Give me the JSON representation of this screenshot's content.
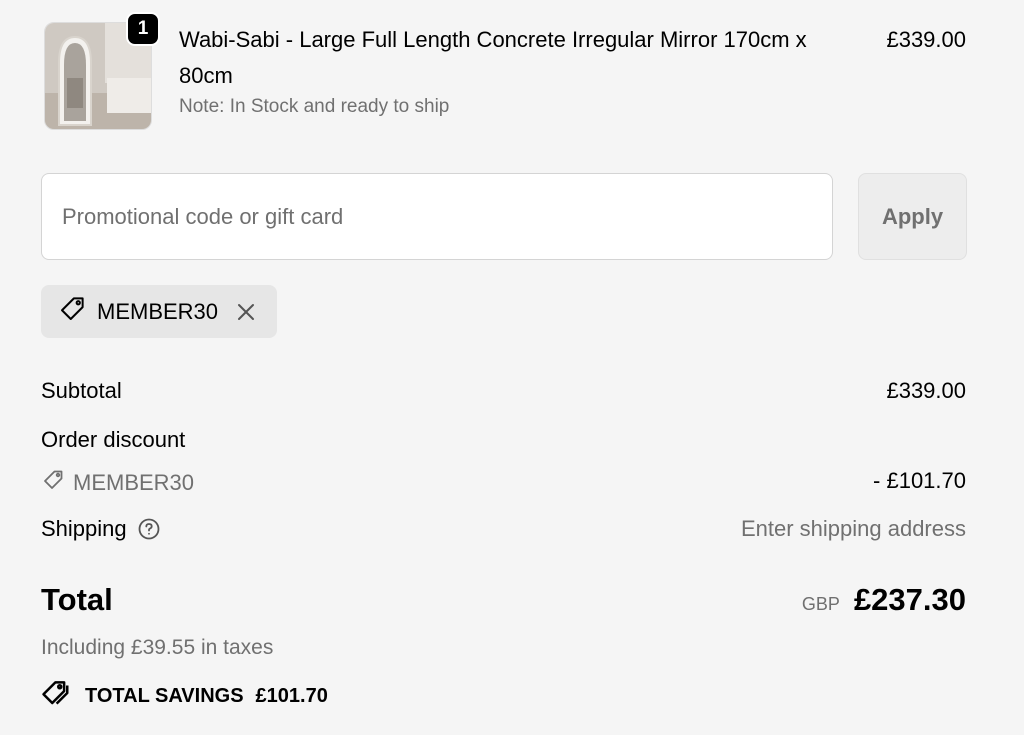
{
  "product": {
    "quantity": "1",
    "title": "Wabi-Sabi - Large Full Length Concrete Irregular Mirror 170cm x 80cm",
    "note": "Note: In Stock and ready to ship",
    "price": "£339.00",
    "image_icon": "mirror-thumbnail"
  },
  "promo": {
    "placeholder": "Promotional code or gift card",
    "apply_label": "Apply"
  },
  "applied_code": {
    "code": "MEMBER30",
    "icon": "tag-icon",
    "remove_icon": "close-icon"
  },
  "summary": {
    "subtotal_label": "Subtotal",
    "subtotal_value": "£339.00",
    "order_discount_label": "Order discount",
    "discount_code": "MEMBER30",
    "discount_value": "- £101.70",
    "shipping_label": "Shipping",
    "shipping_value": "Enter shipping address"
  },
  "total": {
    "label": "Total",
    "currency": "GBP",
    "amount": "£237.30",
    "taxes": "Including £39.55 in taxes"
  },
  "savings": {
    "label": "TOTAL SAVINGS",
    "amount": "£101.70"
  },
  "colors": {
    "background": "#f5f5f5",
    "muted_text": "#707070",
    "chip_bg": "#e6e6e6"
  }
}
